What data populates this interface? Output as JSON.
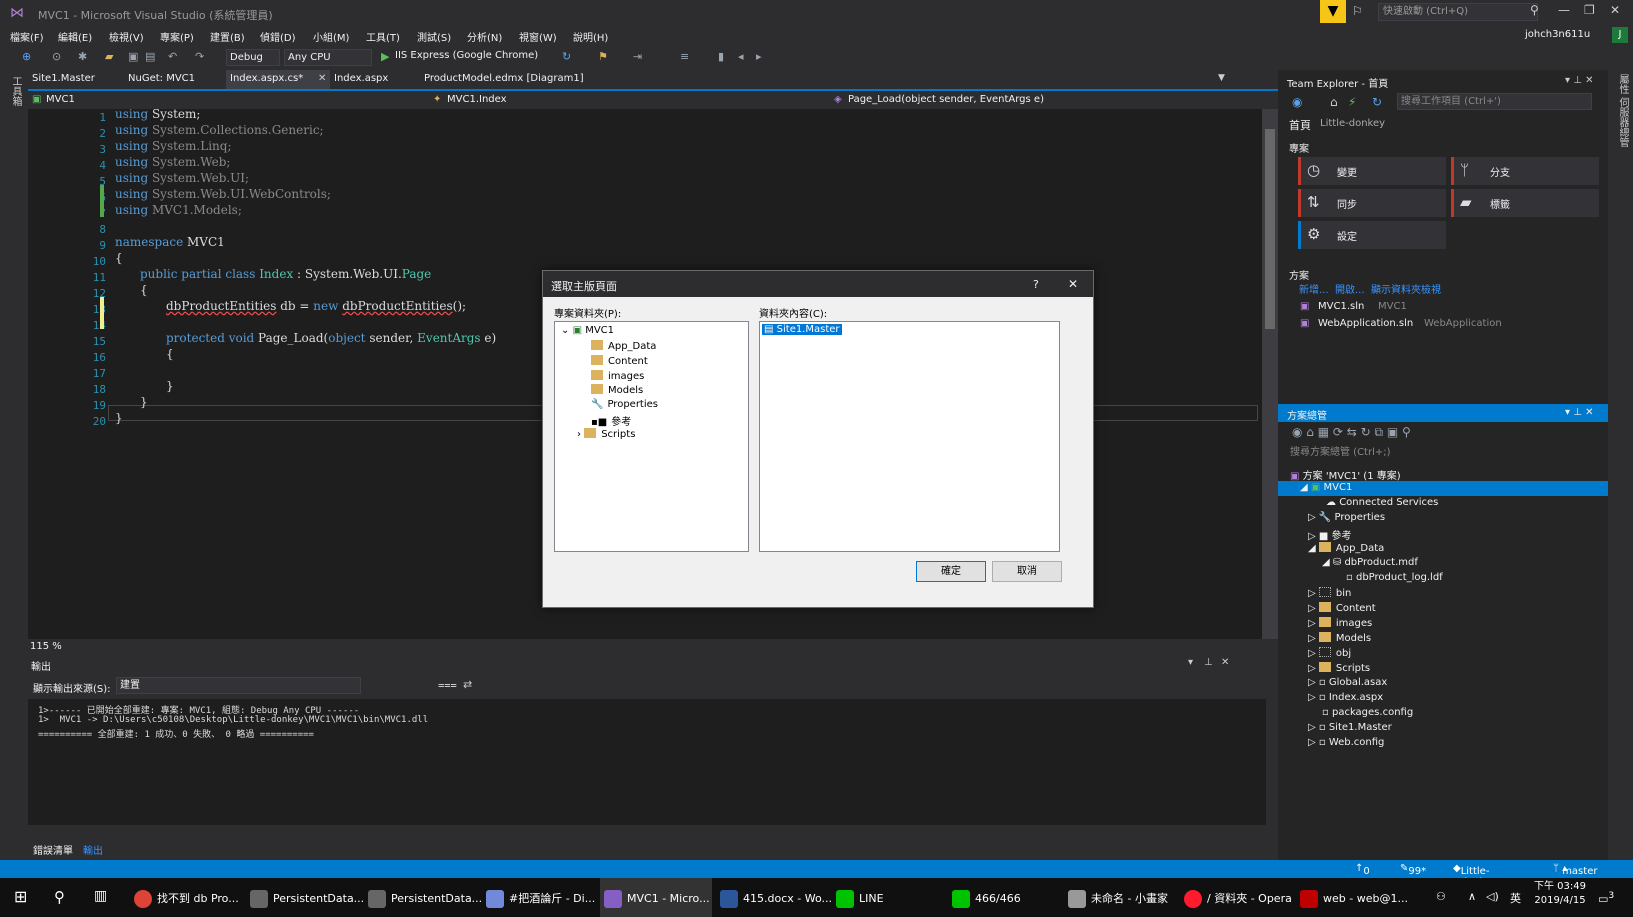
{
  "window": {
    "title": "MVC1 - Microsoft Visual Studio (系統管理員)",
    "quick_launch_placeholder": "快速啟動 (Ctrl+Q)",
    "user": "johch3n611u",
    "avatar": "J"
  },
  "menu": [
    "檔案(F)",
    "編輯(E)",
    "檢視(V)",
    "專案(P)",
    "建置(B)",
    "偵錯(D)",
    "小組(M)",
    "工具(T)",
    "測試(S)",
    "分析(N)",
    "視窗(W)",
    "說明(H)"
  ],
  "toolbar": {
    "config": "Debug",
    "platform": "Any CPU",
    "run_label": "IIS Express (Google Chrome)"
  },
  "left_strip": "工具箱",
  "right_strip": "屬性  伺服器總管",
  "doc_tabs": [
    "Site1.Master",
    "NuGet: MVC1",
    "Index.aspx.cs*",
    "Index.aspx",
    "ProductModel.edmx [Diagram1]"
  ],
  "nav": {
    "project": "MVC1",
    "class": "MVC1.Index",
    "member": "Page_Load(object sender, EventArgs e)"
  },
  "code_lines": [
    "1",
    "2",
    "3",
    "4",
    "5",
    "6",
    "7",
    "8",
    "9",
    "10",
    "11",
    "12",
    "13",
    "14",
    "15",
    "16",
    "17",
    "18",
    "19",
    "20"
  ],
  "code": {
    "l1a": "using",
    "l1b": " System;",
    "l2a": "using",
    "l2b": " System.Collections.Generic;",
    "l3a": "using",
    "l3b": " System.Linq;",
    "l4a": "using",
    "l4b": " System.Web;",
    "l5a": "using",
    "l5b": " System.Web.UI;",
    "l6a": "using",
    "l6b": " System.Web.UI.WebControls;",
    "l7a": "using",
    "l7b": " MVC1.Models;",
    "l9a": "namespace",
    "l9b": " MVC1",
    "l10": "{",
    "l11a": "public partial class",
    "l11b": " Index",
    "l11c": " : System.Web.UI.",
    "l11d": "Page",
    "l12": "{",
    "l13a": "dbProductEntities",
    "l13b": " db = ",
    "l13c": "new",
    "l13d": " ",
    "l13e": "dbProductEntities",
    "l13f": "();",
    "l15a": "protected void",
    "l15b": " Page_Load(",
    "l15c": "object",
    "l15d": " sender, ",
    "l15e": "EventArgs",
    "l15f": " e)",
    "l16": "{",
    "l18": "}",
    "l19": "}",
    "l20": "}"
  },
  "zoom": "115 %",
  "output": {
    "title": "輸出",
    "source_label": "顯示輸出來源(S):",
    "source_value": "建置",
    "lines": [
      "1>------ 已開始全部重建: 專案: MVC1, 組態: Debug Any CPU ------",
      "1>  MVC1 -> D:\\Users\\c50108\\Desktop\\Little-donkey\\MVC1\\MVC1\\bin\\MVC1.dll",
      "========== 全部重建: 1 成功、0 失敗、 0 略過 =========="
    ]
  },
  "bottom_tabs": [
    "錯誤清單",
    "輸出"
  ],
  "team_explorer": {
    "title": "Team Explorer - 首頁",
    "search_placeholder": "搜尋工作項目 (Ctrl+')",
    "home": "首頁",
    "repo": "Little-donkey",
    "project_section": "專案",
    "tiles": [
      "變更",
      "分支",
      "同步",
      "標籤",
      "設定"
    ],
    "solution_section": "方案",
    "links": [
      "新增...",
      "開啟...",
      "顯示資料夾檢視"
    ],
    "solutions": [
      {
        "name": "MVC1.sln",
        "detail": "MVC1"
      },
      {
        "name": "WebApplication.sln",
        "detail": "WebApplication"
      }
    ]
  },
  "solution_explorer": {
    "title": "方案總管",
    "search_placeholder": "搜尋方案總管 (Ctrl+;)",
    "items": [
      "方案 'MVC1' (1 專案)",
      "MVC1",
      "Connected Services",
      "Properties",
      "參考",
      "App_Data",
      "dbProduct.mdf",
      "dbProduct_log.ldf",
      "bin",
      "Content",
      "images",
      "Models",
      "obj",
      "Scripts",
      "Global.asax",
      "Index.aspx",
      "packages.config",
      "Site1.Master",
      "Web.config"
    ]
  },
  "dialog": {
    "title": "選取主版頁面",
    "help": "?",
    "project_label": "專案資料夾(P):",
    "content_label": "資料夾內容(C):",
    "tree": [
      "MVC1",
      "App_Data",
      "Content",
      "images",
      "Models",
      "Properties",
      "參考",
      "Scripts"
    ],
    "contents": [
      "Site1.Master"
    ],
    "ok": "確定",
    "cancel": "取消"
  },
  "status": {
    "up": "0",
    "pencil": "99*",
    "repo": "Little-donkey",
    "branch": "master"
  },
  "taskbar": {
    "items": [
      "找不到 db Pro...",
      "PersistentData...",
      "PersistentData...",
      "#把酒論斤 - Di...",
      "MVC1 - Micro...",
      "415.docx - Wo...",
      "LINE",
      "466/466",
      "未命名 - 小畫家",
      "/ 資料夾 - Opera",
      "web - web@1..."
    ],
    "ime": "英",
    "time": "下午 03:49",
    "date": "2019/4/15",
    "notif": "3"
  }
}
